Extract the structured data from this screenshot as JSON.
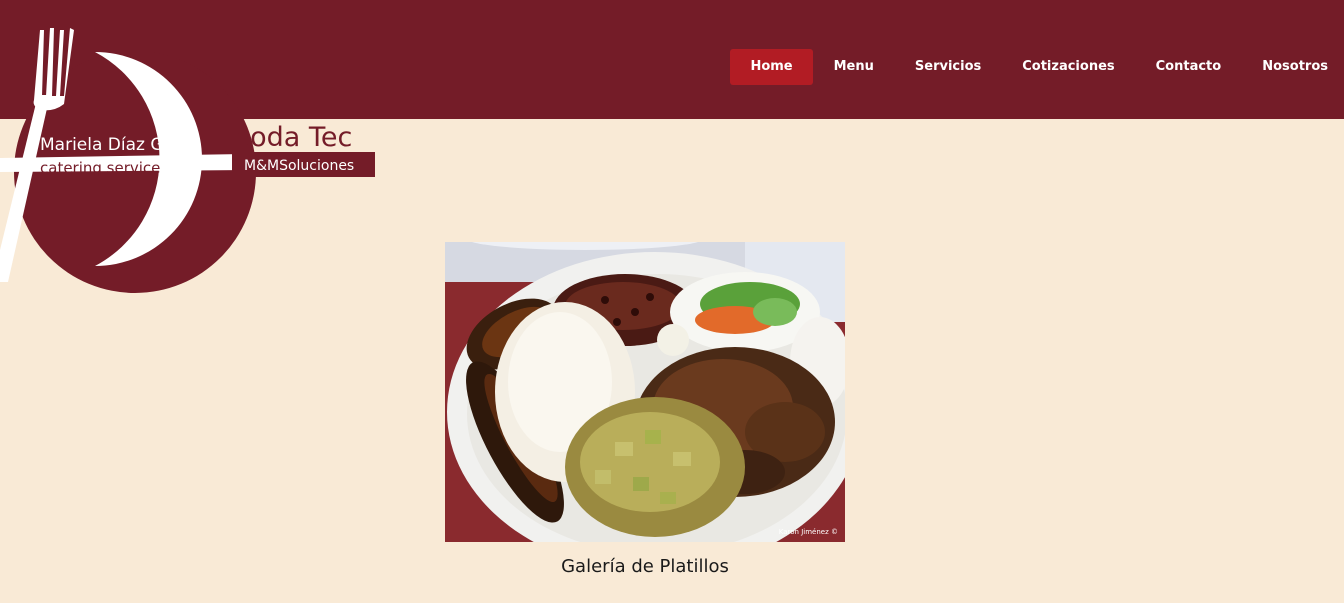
{
  "brand": {
    "owner_name": "Mariela Díaz Garro",
    "tagline": "catering service",
    "business_name": "Soda Tec",
    "partner": "M&MSoluciones"
  },
  "nav": {
    "items": [
      "Home",
      "Menu",
      "Servicios",
      "Cotizaciones",
      "Contacto",
      "Nosotros"
    ],
    "active": "Home"
  },
  "gallery": {
    "photo_credit": "Karon Jiménez ©",
    "caption": "Galería de Platillos"
  },
  "colors": {
    "header": "#741c28",
    "nav_active": "#b21c24",
    "page_background": "#f9ead6"
  }
}
